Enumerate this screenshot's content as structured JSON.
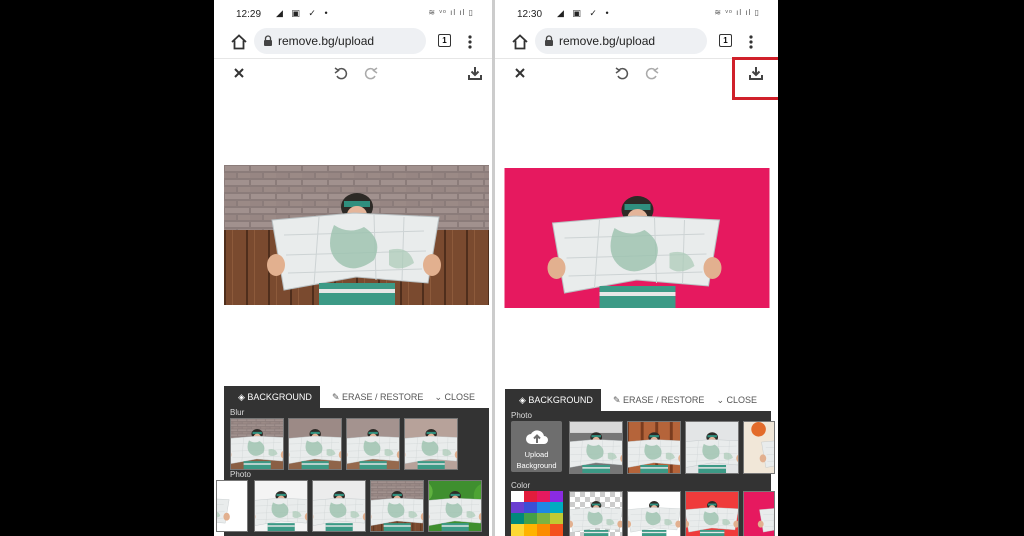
{
  "left": {
    "status": {
      "time": "12:29",
      "left_icons": "◢ ▣ ✓ •",
      "right_icons": "≋ ᵛᵒ ıl ıl ▯"
    },
    "browser": {
      "url": "remove.bg/upload",
      "tab_count": "1"
    },
    "tabs": {
      "background": "BACKGROUND",
      "erase": "ERASE / RESTORE",
      "close": "CLOSE"
    },
    "sections": {
      "first": "Blur",
      "second": "Photo"
    }
  },
  "right": {
    "status": {
      "time": "12:30",
      "left_icons": "◢ ▣ ✓ •",
      "right_icons": "≋ ᵛᵒ ıl ıl ▯"
    },
    "browser": {
      "url": "remove.bg/upload",
      "tab_count": "1"
    },
    "tabs": {
      "background": "BACKGROUND",
      "erase": "ERASE / RESTORE",
      "close": "CLOSE"
    },
    "sections": {
      "first": "Photo",
      "second": "Color"
    },
    "upload": {
      "line1": "Upload",
      "line2": "Background"
    }
  },
  "colors": {
    "magenta_bg": "#e6195f",
    "panel": "#333333",
    "highlight": "#d0202a"
  }
}
